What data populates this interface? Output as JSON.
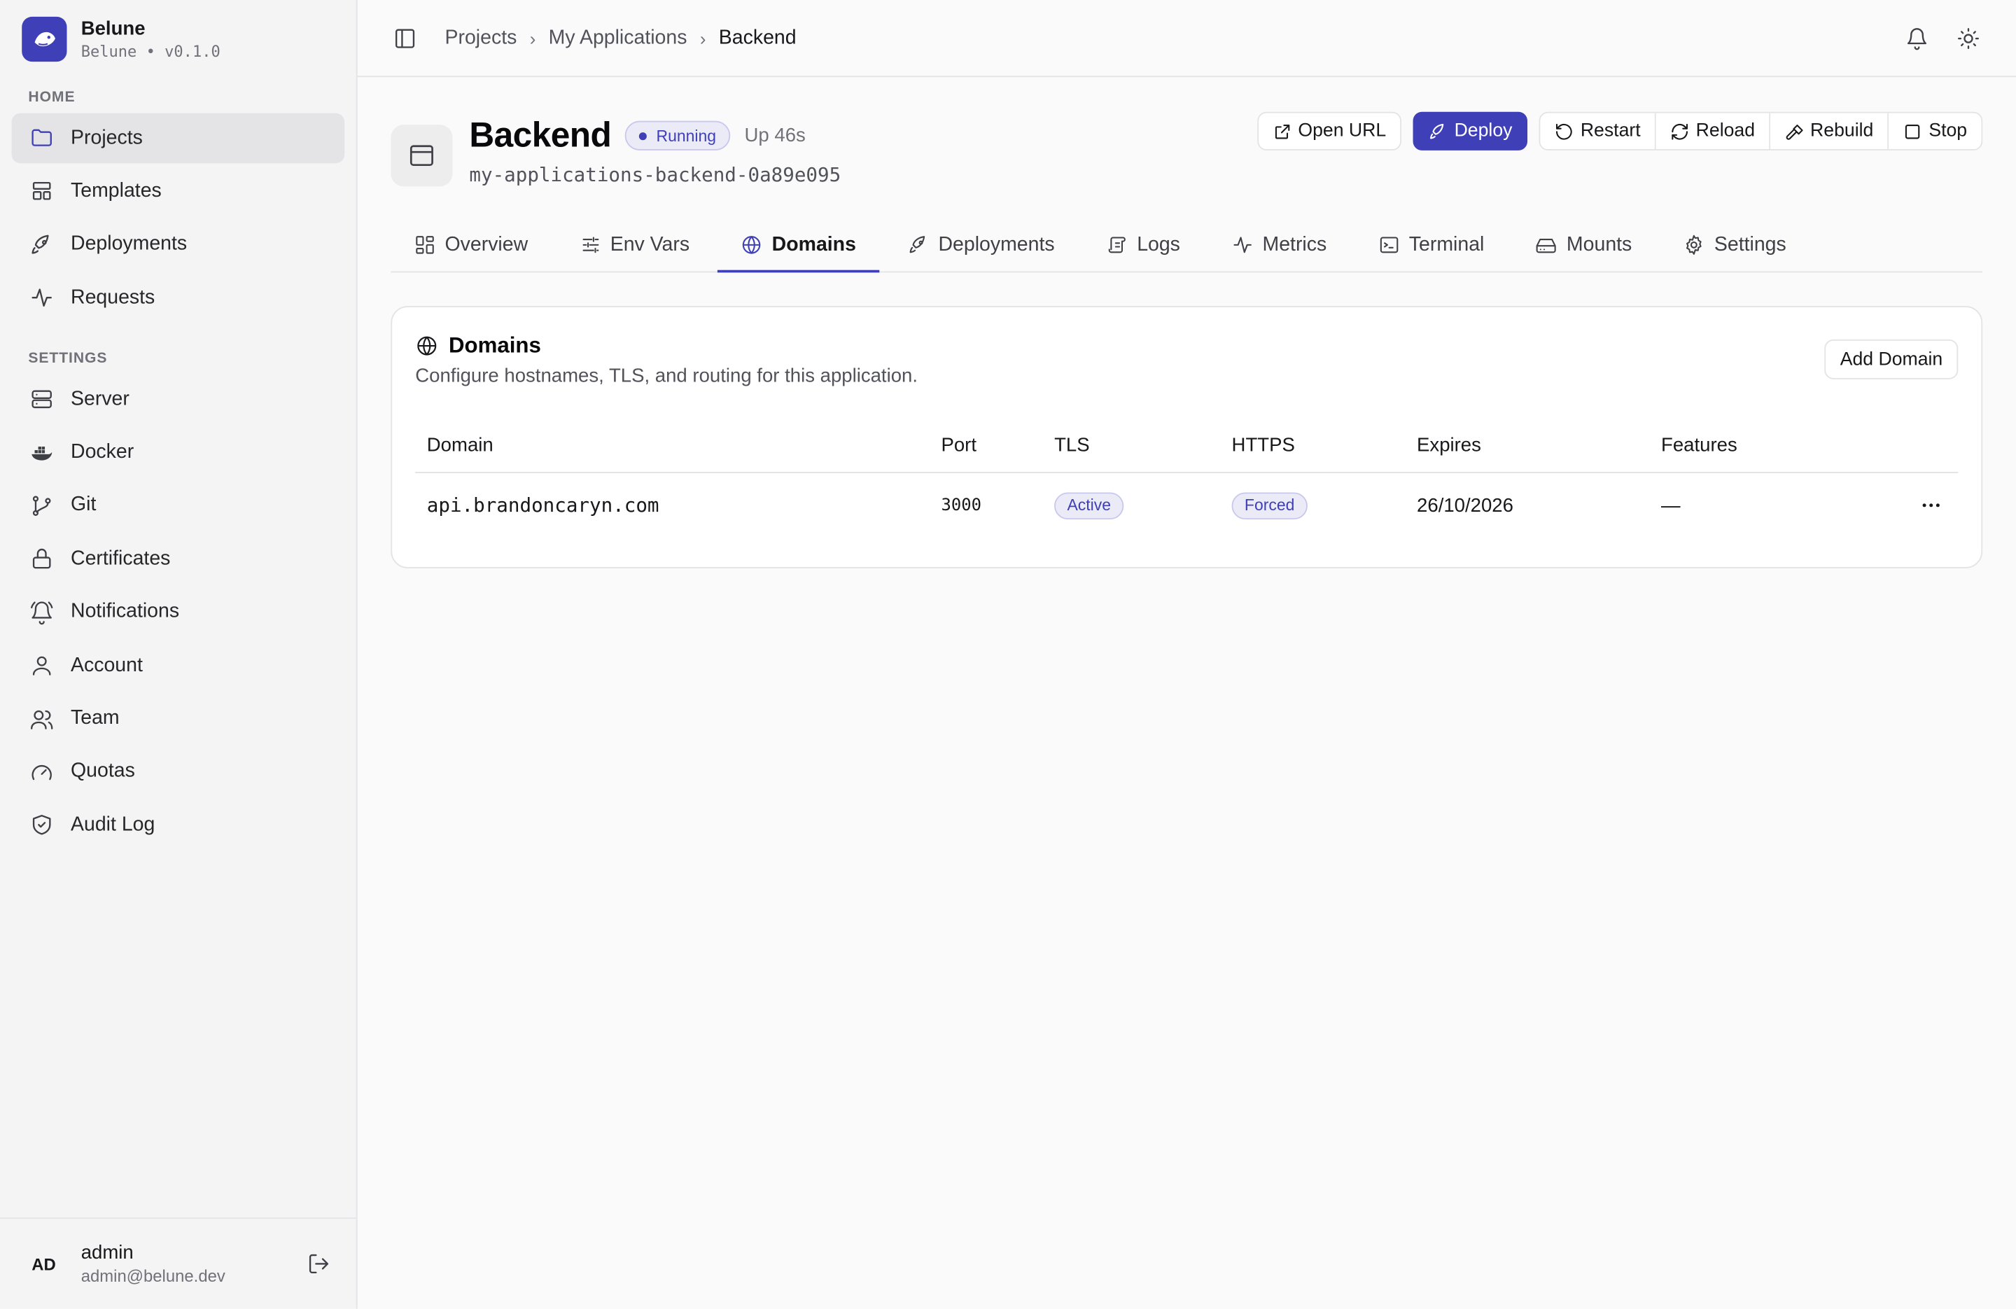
{
  "brand": {
    "name": "Belune",
    "subtitle": "Belune • v0.1.0"
  },
  "sidebar": {
    "home_label": "HOME",
    "home_items": [
      {
        "label": "Projects",
        "icon": "folder-icon"
      },
      {
        "label": "Templates",
        "icon": "layout-icon"
      },
      {
        "label": "Deployments",
        "icon": "rocket-icon"
      },
      {
        "label": "Requests",
        "icon": "activity-icon"
      }
    ],
    "settings_label": "SETTINGS",
    "settings_items": [
      {
        "label": "Server",
        "icon": "server-icon"
      },
      {
        "label": "Docker",
        "icon": "docker-icon"
      },
      {
        "label": "Git",
        "icon": "git-branch-icon"
      },
      {
        "label": "Certificates",
        "icon": "lock-icon"
      },
      {
        "label": "Notifications",
        "icon": "bell-icon"
      },
      {
        "label": "Account",
        "icon": "user-icon"
      },
      {
        "label": "Team",
        "icon": "users-icon"
      },
      {
        "label": "Quotas",
        "icon": "gauge-icon"
      },
      {
        "label": "Audit Log",
        "icon": "shield-check-icon"
      }
    ]
  },
  "user": {
    "initials": "AD",
    "name": "admin",
    "email": "admin@belune.dev"
  },
  "breadcrumb": {
    "items": [
      "Projects",
      "My Applications",
      "Backend"
    ]
  },
  "app": {
    "title": "Backend",
    "status": "Running",
    "uptime": "Up 46s",
    "slug": "my-applications-backend-0a89e095"
  },
  "actions": {
    "open_url": "Open URL",
    "deploy": "Deploy",
    "restart": "Restart",
    "reload": "Reload",
    "rebuild": "Rebuild",
    "stop": "Stop"
  },
  "tabs": [
    "Overview",
    "Env Vars",
    "Domains",
    "Deployments",
    "Logs",
    "Metrics",
    "Terminal",
    "Mounts",
    "Settings"
  ],
  "domains_card": {
    "title": "Domains",
    "description": "Configure hostnames, TLS, and routing for this application.",
    "add_button": "Add Domain",
    "columns": [
      "Domain",
      "Port",
      "TLS",
      "HTTPS",
      "Expires",
      "Features"
    ],
    "rows": [
      {
        "domain": "api.brandoncaryn.com",
        "port": "3000",
        "tls": "Active",
        "https": "Forced",
        "expires": "26/10/2026",
        "features": "—"
      }
    ]
  },
  "colors": {
    "accent": "#3f3fb8",
    "sidebar_bg": "#f4f4f5",
    "page_bg": "#fafafa"
  }
}
